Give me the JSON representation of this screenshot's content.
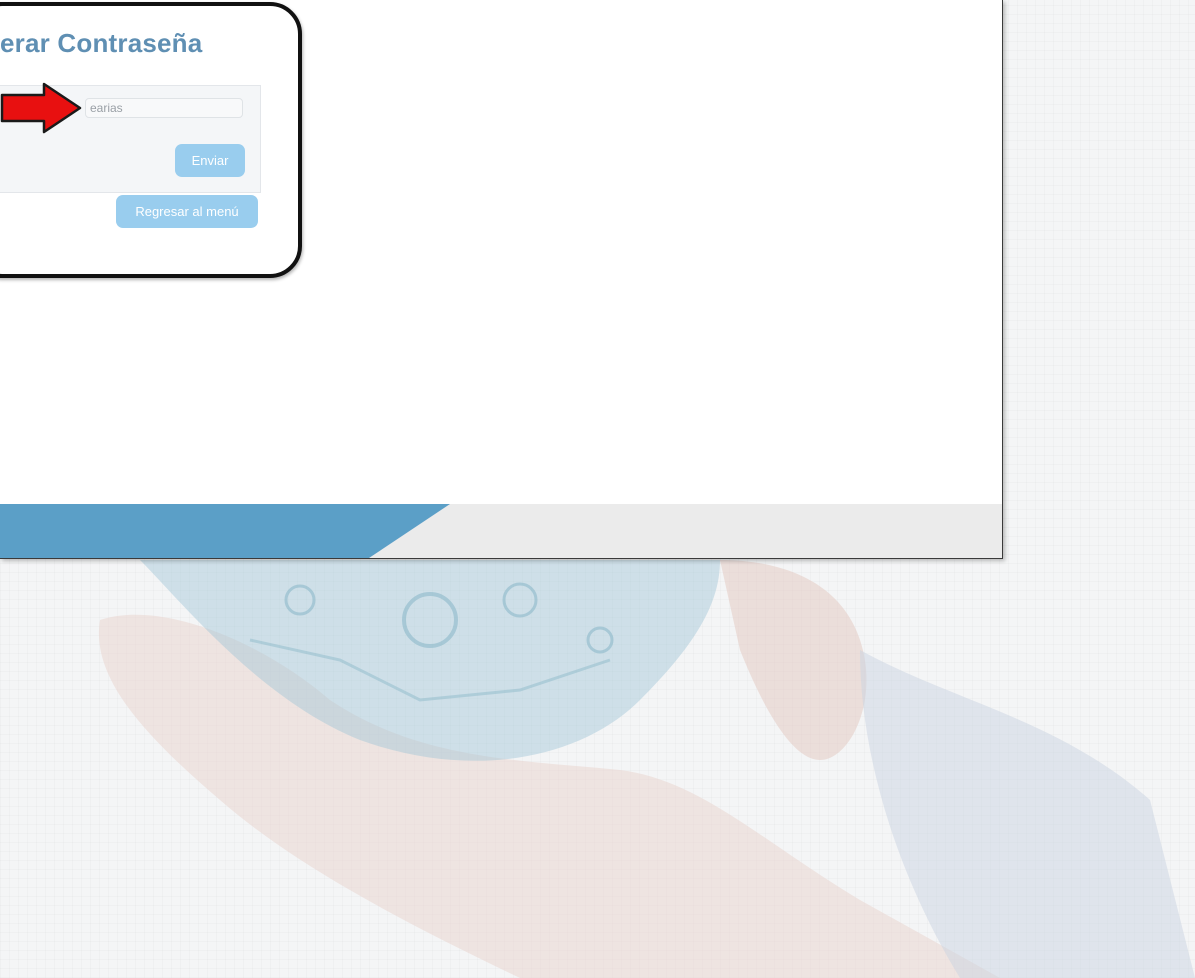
{
  "page": {
    "title": "erar Contraseña"
  },
  "form": {
    "username_value": "earias",
    "send_label": "Enviar",
    "back_label": "Regresar al menú"
  },
  "colors": {
    "title": "#5f8fb3",
    "button": "#99cdee",
    "footer_accent": "#5b9fc7",
    "arrow": "#e81010"
  },
  "icons": {
    "annotation": "red-arrow-icon"
  }
}
